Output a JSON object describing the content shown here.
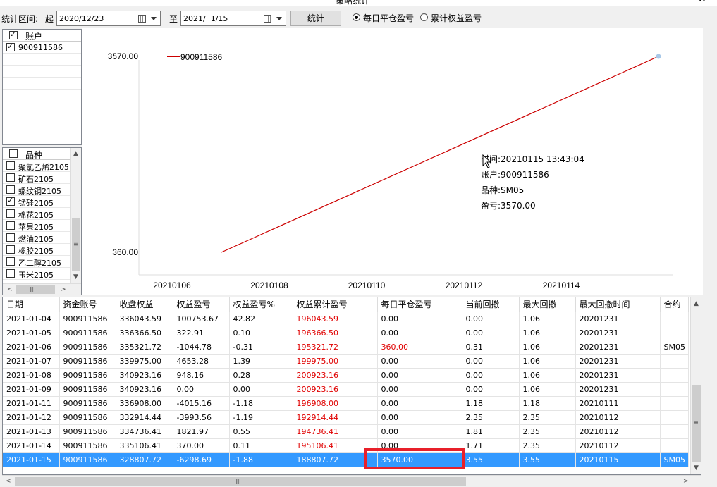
{
  "window": {
    "title": "策略统计",
    "close_glyph": "✕"
  },
  "toolbar": {
    "range_label": "统计区间:",
    "start_label": "起",
    "start_date": "2020/12/23",
    "to_label": "至",
    "end_date": "2021/  1/15",
    "stat_button": "统计",
    "radio_daily": "每日平仓盈亏",
    "radio_cumulative": "累计权益盈亏",
    "radio_selected": "daily"
  },
  "accounts": {
    "header": "账户",
    "items": [
      {
        "label": "900911586",
        "checked": true
      }
    ]
  },
  "products": {
    "header": "品种",
    "items": [
      {
        "label": "聚氯乙烯2105",
        "checked": false
      },
      {
        "label": "矿石2105",
        "checked": false
      },
      {
        "label": "螺纹钢2105",
        "checked": false
      },
      {
        "label": "锰硅2105",
        "checked": true
      },
      {
        "label": "棉花2105",
        "checked": false
      },
      {
        "label": "苹果2105",
        "checked": false
      },
      {
        "label": "燃油2105",
        "checked": false
      },
      {
        "label": "橡胶2105",
        "checked": false
      },
      {
        "label": "乙二醇2105",
        "checked": false
      },
      {
        "label": "玉米2105",
        "checked": false
      }
    ]
  },
  "chart_data": {
    "type": "line",
    "series": [
      {
        "name": "900911586",
        "color": "#cc0000",
        "x": [
          "20210106",
          "20210115"
        ],
        "y": [
          360.0,
          3570.0
        ]
      }
    ],
    "x_ticks": [
      "20210106",
      "20210108",
      "20210110",
      "20210112",
      "20210114"
    ],
    "y_ticks": [
      "3570.00",
      "360.00"
    ],
    "ylim": [
      360.0,
      3570.0
    ],
    "grid": false,
    "legend_position": "top-left",
    "tooltip": {
      "time": "时间:20210115 13:43:04",
      "account": "账户:900911586",
      "product": "品种:SM05",
      "pnl": "盈亏:3570.00"
    }
  },
  "table": {
    "columns": [
      "日期",
      "资金账号",
      "收盘权益",
      "权益盈亏",
      "权益盈亏%",
      "权益累计盈亏",
      "每日平仓盈亏",
      "当前回撤",
      "最大回撤",
      "最大回撤时间",
      "合约"
    ],
    "rows": [
      [
        "2021-01-04",
        "900911586",
        "336043.59",
        "100753.67",
        "42.82",
        "196043.59",
        "0.00",
        "0.00",
        "1.06",
        "20201231",
        ""
      ],
      [
        "2021-01-05",
        "900911586",
        "336366.50",
        "322.91",
        "0.10",
        "196366.50",
        "0.00",
        "0.00",
        "1.06",
        "20201231",
        ""
      ],
      [
        "2021-01-06",
        "900911586",
        "335321.72",
        "-1044.78",
        "-0.31",
        "195321.72",
        "360.00",
        "0.31",
        "1.06",
        "20201231",
        "SM05"
      ],
      [
        "2021-01-07",
        "900911586",
        "339975.00",
        "4653.28",
        "1.39",
        "199975.00",
        "0.00",
        "0.00",
        "1.06",
        "20201231",
        ""
      ],
      [
        "2021-01-08",
        "900911586",
        "340923.16",
        "948.16",
        "0.28",
        "200923.16",
        "0.00",
        "0.00",
        "1.06",
        "20201231",
        ""
      ],
      [
        "2021-01-09",
        "900911586",
        "340923.16",
        "0.00",
        "0.00",
        "200923.16",
        "0.00",
        "0.00",
        "1.06",
        "20201231",
        ""
      ],
      [
        "2021-01-11",
        "900911586",
        "336908.00",
        "-4015.16",
        "-1.18",
        "196908.00",
        "0.00",
        "1.18",
        "1.18",
        "20210111",
        ""
      ],
      [
        "2021-01-12",
        "900911586",
        "332914.44",
        "-3993.56",
        "-1.19",
        "192914.44",
        "0.00",
        "2.35",
        "2.35",
        "20210112",
        ""
      ],
      [
        "2021-01-13",
        "900911586",
        "334736.41",
        "1821.97",
        "0.55",
        "194736.41",
        "0.00",
        "1.81",
        "2.35",
        "20210112",
        ""
      ],
      [
        "2021-01-14",
        "900911586",
        "335106.41",
        "370.00",
        "0.11",
        "195106.41",
        "0.00",
        "1.71",
        "2.35",
        "20210112",
        ""
      ],
      [
        "2021-01-15",
        "900911586",
        "328807.72",
        "-6298.69",
        "-1.88",
        "188807.72",
        "3570.00",
        "3.55",
        "3.55",
        "20210115",
        "SM05"
      ]
    ],
    "selected_row": 10,
    "red_columns": [
      5
    ],
    "red_cells": [
      [
        2,
        6
      ]
    ],
    "colors": {
      "red": "#e00000",
      "selection": "#3399ff",
      "highlight_box": "#e8202a"
    }
  }
}
